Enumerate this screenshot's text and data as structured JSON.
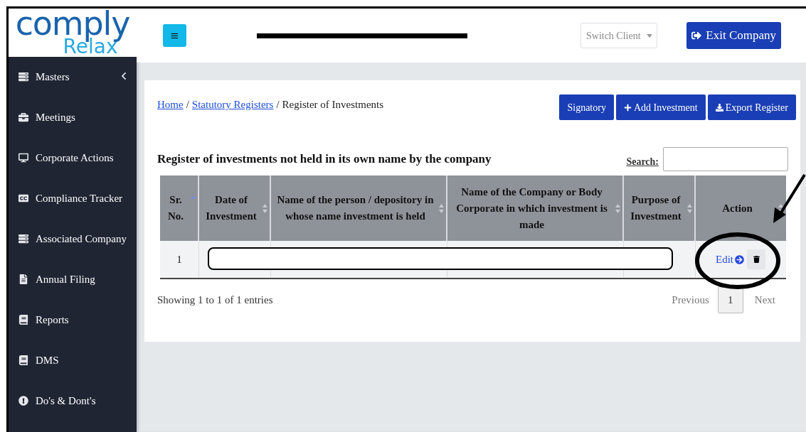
{
  "logo": {
    "top": "comply",
    "bottom": "Relax"
  },
  "header": {
    "menu_button": "≡",
    "switch_client": "Switch Client",
    "exit_button": "Exit Company"
  },
  "sidebar": {
    "items": [
      {
        "label": "Masters",
        "expandable": true
      },
      {
        "label": "Meetings",
        "expandable": false
      },
      {
        "label": "Corporate Actions",
        "expandable": false
      },
      {
        "label": "Compliance Tracker",
        "expandable": false
      },
      {
        "label": "Associated Company",
        "expandable": false
      },
      {
        "label": "Annual Filing",
        "expandable": false
      },
      {
        "label": "Reports",
        "expandable": false
      },
      {
        "label": "DMS",
        "expandable": false
      },
      {
        "label": "Do's & Dont's",
        "expandable": false
      }
    ]
  },
  "breadcrumb": {
    "separator": "/",
    "items": [
      {
        "label": "Home",
        "link": true
      },
      {
        "label": "Statutory Registers",
        "link": true
      },
      {
        "label": "Register of Investments",
        "link": false
      }
    ]
  },
  "actions": [
    {
      "label": "Signatory"
    },
    {
      "label": "Add Investment"
    },
    {
      "label": "Export Register"
    }
  ],
  "table_title": "Register of investments not held in its own name by the company",
  "search": {
    "label": "Search:"
  },
  "table": {
    "columns": [
      {
        "label": "Sr. No.",
        "sorted": true
      },
      {
        "label": "Date of Investment",
        "sorted": false
      },
      {
        "label": "Name of the person / depository in whose name investment is held",
        "sorted": false
      },
      {
        "label": "Name of the Company or Body Corporate in which investment is made",
        "sorted": false
      },
      {
        "label": "Purpose of Investment",
        "sorted": false
      },
      {
        "label": "Action",
        "sorted": false
      }
    ],
    "rows": [
      {
        "sr": "1",
        "edit": "Edit"
      }
    ]
  },
  "footer": {
    "info": "Showing 1 to 1 of 1 entries",
    "previous": "Previous",
    "page": "1",
    "next": "Next"
  }
}
